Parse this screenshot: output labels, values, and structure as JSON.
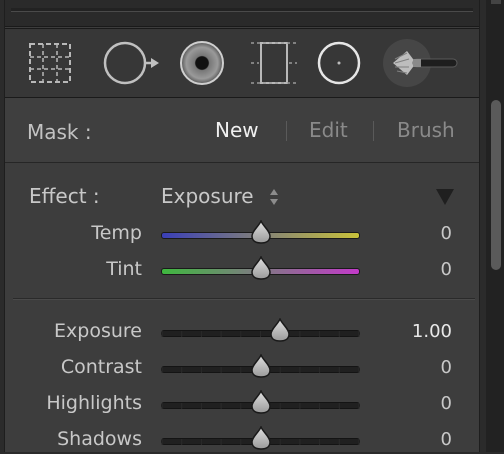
{
  "mask": {
    "label": "Mask :",
    "options": [
      "New",
      "Edit",
      "Brush"
    ],
    "active": "New"
  },
  "effect": {
    "label": "Effect :",
    "value": "Exposure"
  },
  "sliders": [
    {
      "label": "Temp",
      "value": "0",
      "position": 0.5,
      "track": "temp"
    },
    {
      "label": "Tint",
      "value": "0",
      "position": 0.5,
      "track": "tint"
    },
    {
      "label": "Exposure",
      "value": "1.00",
      "position": 0.6,
      "track": "plain"
    },
    {
      "label": "Contrast",
      "value": "0",
      "position": 0.5,
      "track": "plain"
    },
    {
      "label": "Highlights",
      "value": "0",
      "position": 0.5,
      "track": "plain"
    },
    {
      "label": "Shadows",
      "value": "0",
      "position": 0.5,
      "track": "plain"
    }
  ],
  "tools": [
    {
      "icon": "crop-overlay-icon"
    },
    {
      "icon": "spot-removal-icon"
    },
    {
      "icon": "red-eye-correction-icon"
    },
    {
      "icon": "graduated-filter-icon"
    },
    {
      "icon": "radial-filter-icon"
    },
    {
      "icon": "adjustment-brush-icon"
    }
  ],
  "colors": {
    "temp_start": "#3a3fb8",
    "temp_end": "#c9c23a",
    "tint_start": "#3fb83f",
    "tint_end": "#c23ac9"
  }
}
